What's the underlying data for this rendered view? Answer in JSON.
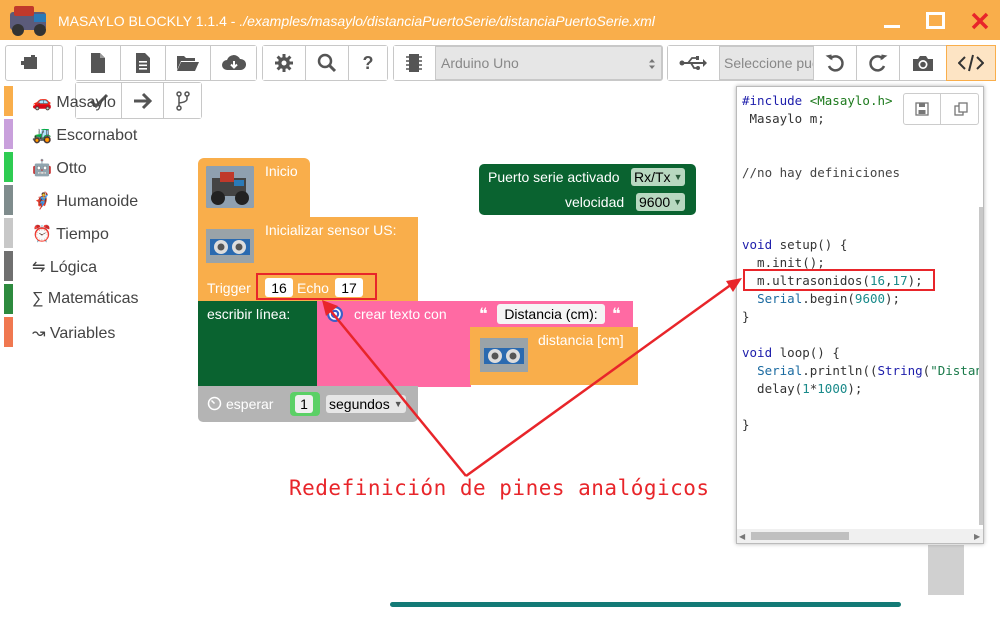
{
  "window": {
    "title_prefix": "MASAYLO BLOCKLY 1.1.4 - ",
    "title_path": "./examples/masaylo/distanciaPuertoSerie/distanciaPuertoSerie.xml",
    "colors": {
      "titlebar": "#f9ae4b",
      "close": "#e8252a"
    }
  },
  "toolbar": {
    "board_select": "Arduino Uno",
    "port_select": "Seleccione puerto",
    "icons": [
      "blocks-icon",
      "new-file-icon",
      "file-icon",
      "open-folder-icon",
      "cloud-download-icon",
      "gear-icon",
      "search-icon",
      "help-icon",
      "chip-icon",
      "usb-icon",
      "undo-icon",
      "redo-icon",
      "camera-icon",
      "code-icon",
      "check-icon",
      "arrow-right-icon",
      "branch-icon"
    ]
  },
  "categories": [
    {
      "label": "Masaylo",
      "color": "#f9ae4b"
    },
    {
      "label": "Escornabot",
      "color": "#c9a0dc"
    },
    {
      "label": "Otto",
      "color": "#2ecc52"
    },
    {
      "label": "Humanoide",
      "color": "#7f8c8d"
    },
    {
      "label": "Tiempo",
      "color": "#c8c8c8"
    },
    {
      "label": "Lógica",
      "color": "#707070"
    },
    {
      "label": "Matemáticas",
      "color": "#2d8a3e"
    },
    {
      "label": "Variables",
      "color": "#f07850"
    }
  ],
  "blocks": {
    "inicio": "Inicio",
    "init_sensor": "Inicializar sensor US:",
    "trigger_label": "Trigger",
    "trigger_value": "16",
    "echo_label": "Echo",
    "echo_value": "17",
    "escribir": "escribir línea:",
    "crear_texto": "crear texto con",
    "quote": "❝",
    "distancia_text": "Distancia (cm):",
    "distancia_cm": "distancia [cm]",
    "esperar": "esperar",
    "esperar_value": "1",
    "segundos": "segundos",
    "serial_label": "Puerto serie activado",
    "serial_value": "Rx/Tx",
    "velocidad_label": "velocidad",
    "velocidad_value": "9600"
  },
  "code": {
    "l1a": "#include ",
    "l1b": "<Masaylo.h>",
    "l2": " Masaylo m;",
    "l3": "//no hay definiciones",
    "l4a": "void ",
    "l4b": "setup",
    "l4c": "() {",
    "l5a": "  m.",
    "l5b": "init",
    "l5c": "();",
    "l6a": "  m.",
    "l6b": "ultrasonidos",
    "l6c": "(",
    "l6d": "16",
    "l6e": ",",
    "l6f": "17",
    "l6g": ");",
    "l7a": "  ",
    "l7b": "Serial",
    "l7c": ".",
    "l7d": "begin",
    "l7e": "(",
    "l7f": "9600",
    "l7g": ");",
    "l8": "}",
    "l9a": "void ",
    "l9b": "loop",
    "l9c": "() {",
    "l10a": "  ",
    "l10b": "Serial",
    "l10c": ".",
    "l10d": "println",
    "l10e": "((",
    "l10f": "String",
    "l10g": "(",
    "l10h": "\"Distan",
    "l11a": "  delay(",
    "l11b": "1",
    "l11c": "*",
    "l11d": "1000",
    "l11e": ");",
    "l12": "}"
  },
  "annotation": "Redefinición de pines analógicos"
}
